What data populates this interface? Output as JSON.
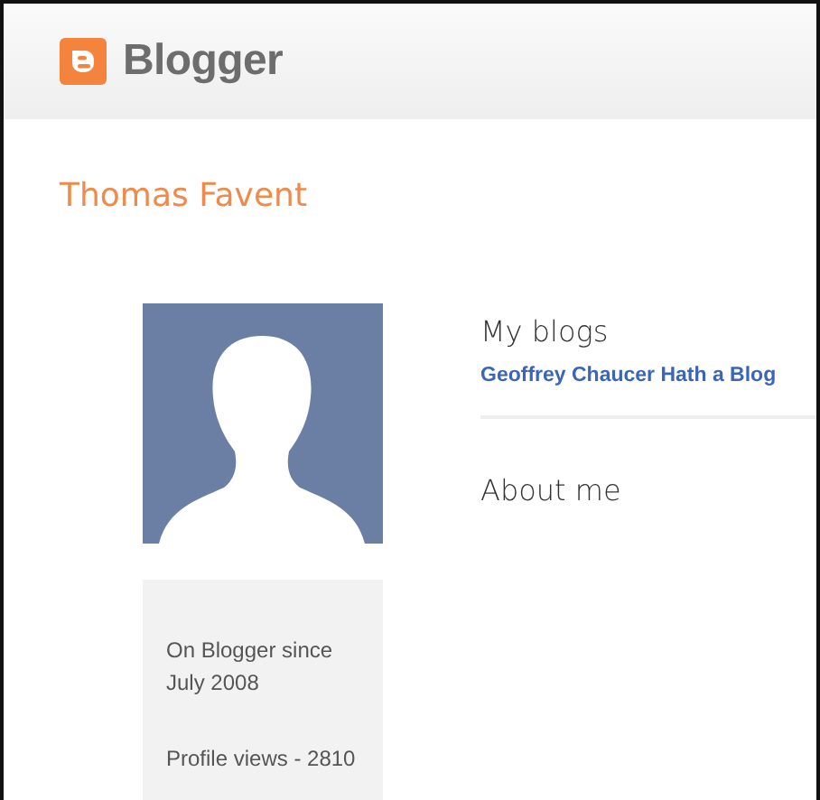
{
  "header": {
    "brand": "Blogger"
  },
  "profile": {
    "name": "Thomas Favent",
    "since": "On Blogger since July 2008",
    "views": "Profile views - 2810"
  },
  "sections": [
    {
      "title": "My blogs",
      "links": [
        "Geoffrey Chaucer Hath a Blog"
      ]
    },
    {
      "title": "About me"
    }
  ]
}
